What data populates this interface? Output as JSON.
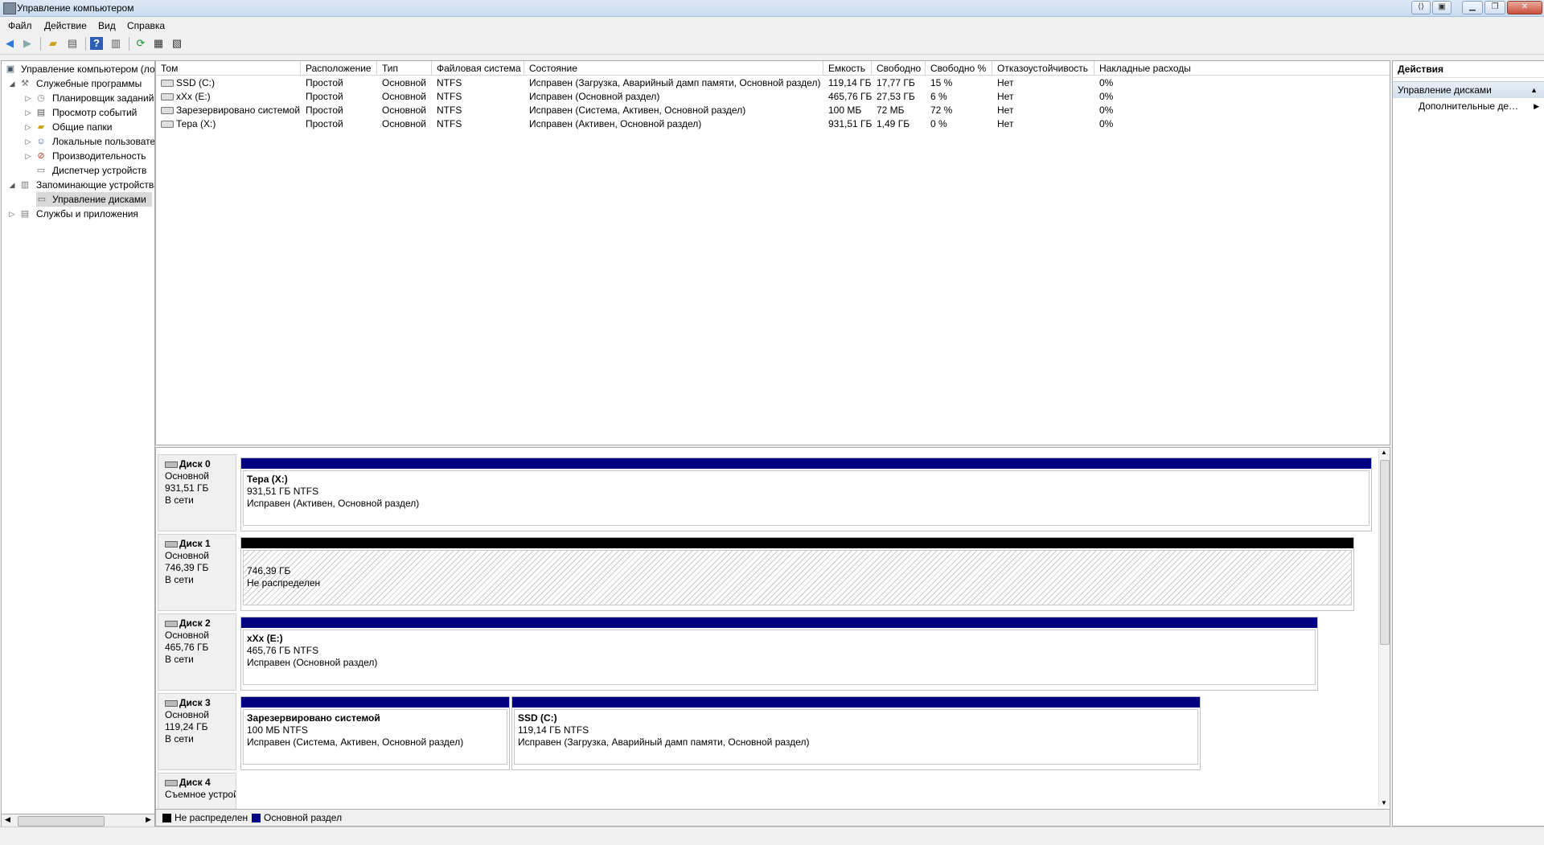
{
  "window": {
    "title": "Управление компьютером"
  },
  "menu": [
    "Файл",
    "Действие",
    "Вид",
    "Справка"
  ],
  "toolbar": {
    "icons": [
      "back-icon",
      "forward-icon",
      "up-folder-icon",
      "show-hide-tree-icon",
      "help-icon",
      "show-hide-action-pane-icon",
      "refresh-icon",
      "properties-icon",
      "export-list-icon"
    ]
  },
  "tree": {
    "root": "Управление компьютером (локальным)",
    "items": [
      {
        "label": "Служебные программы",
        "level": 1,
        "expanded": true
      },
      {
        "label": "Планировщик заданий",
        "level": 2
      },
      {
        "label": "Просмотр событий",
        "level": 2
      },
      {
        "label": "Общие папки",
        "level": 2
      },
      {
        "label": "Локальные пользователи и группы",
        "level": 2
      },
      {
        "label": "Производительность",
        "level": 2
      },
      {
        "label": "Диспетчер устройств",
        "level": 2
      },
      {
        "label": "Запоминающие устройства",
        "level": 1,
        "expanded": true
      },
      {
        "label": "Управление дисками",
        "level": 2,
        "selected": true
      },
      {
        "label": "Службы и приложения",
        "level": 1
      }
    ]
  },
  "volumes": {
    "columns": [
      "Том",
      "Расположение",
      "Тип",
      "Файловая система",
      "Состояние",
      "Емкость",
      "Свободно",
      "Свободно %",
      "Отказоустойчивость",
      "Накладные расходы"
    ],
    "rows": [
      [
        "SSD (C:)",
        "Простой",
        "Основной",
        "NTFS",
        "Исправен (Загрузка, Аварийный дамп памяти, Основной раздел)",
        "119,14 ГБ",
        "17,77 ГБ",
        "15 %",
        "Нет",
        "0%"
      ],
      [
        "xXx (E:)",
        "Простой",
        "Основной",
        "NTFS",
        "Исправен (Основной раздел)",
        "465,76 ГБ",
        "27,53 ГБ",
        "6 %",
        "Нет",
        "0%"
      ],
      [
        "Зарезервировано системой",
        "Простой",
        "Основной",
        "NTFS",
        "Исправен (Система, Активен, Основной раздел)",
        "100 МБ",
        "72 МБ",
        "72 %",
        "Нет",
        "0%"
      ],
      [
        "Тера (X:)",
        "Простой",
        "Основной",
        "NTFS",
        "Исправен (Активен, Основной раздел)",
        "931,51 ГБ",
        "1,49 ГБ",
        "0 %",
        "Нет",
        "0%"
      ]
    ]
  },
  "disks": [
    {
      "name": "Диск 0",
      "type": "Основной",
      "size": "931,51 ГБ",
      "status": "В сети",
      "partitions": [
        {
          "title": "Тера  (X:)",
          "line1": "931,51 ГБ NTFS",
          "line2": "Исправен (Активен, Основной раздел)"
        }
      ]
    },
    {
      "name": "Диск 1",
      "type": "Основной",
      "size": "746,39 ГБ",
      "status": "В сети",
      "partitions": [
        {
          "title": "",
          "line1": "746,39 ГБ",
          "line2": "Не распределен"
        }
      ]
    },
    {
      "name": "Диск 2",
      "type": "Основной",
      "size": "465,76 ГБ",
      "status": "В сети",
      "partitions": [
        {
          "title": "xXx  (E:)",
          "line1": "465,76 ГБ NTFS",
          "line2": "Исправен (Основной раздел)"
        }
      ]
    },
    {
      "name": "Диск 3",
      "type": "Основной",
      "size": "119,24 ГБ",
      "status": "В сети",
      "partitions": [
        {
          "title": "Зарезервировано системой",
          "line1": "100 МБ NTFS",
          "line2": "Исправен (Система, Активен, Основной раздел)"
        },
        {
          "title": "SSD  (C:)",
          "line1": "119,14 ГБ NTFS",
          "line2": "Исправен (Загрузка, Аварийный дамп памяти, Основной раздел)"
        }
      ]
    },
    {
      "name": "Диск 4",
      "type": "Съемное устройство"
    }
  ],
  "legend": [
    {
      "label": "Не распределен",
      "color": "#000000"
    },
    {
      "label": "Основной раздел",
      "color": "#000080"
    }
  ],
  "actions": {
    "header": "Действия",
    "section": "Управление дисками",
    "items": [
      "Дополнительные действия"
    ]
  }
}
